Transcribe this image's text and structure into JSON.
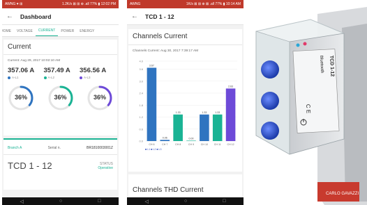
{
  "phone1": {
    "status": {
      "left": "AWNG ♥ ⊞",
      "right": "1.2K/s ⊠ ⊞ ⊕ .all 77% ▮ 12:02 PM"
    },
    "title": "Dashboard",
    "tabs": [
      "HOME",
      "VOLTAGE",
      "CURRENT",
      "POWER",
      "ENERGY"
    ],
    "active_tab": "CURRENT",
    "section_title": "Current",
    "timestamp": "Current: Aug 29, 2017 10:02:10 AM",
    "phases": [
      {
        "value": "357.06 A",
        "label": "A-L1",
        "color": "#2f74c0",
        "percent_text": "36%",
        "percent": 36
      },
      {
        "value": "357.49 A",
        "label": "A-L2",
        "color": "#1ab394",
        "percent_text": "36%",
        "percent": 36
      },
      {
        "value": "356.56 A",
        "label": "A-L3",
        "color": "#6d4ad8",
        "percent_text": "36%",
        "percent": 36
      }
    ],
    "branch": {
      "name": "Branch A",
      "serial_label": "Serial n.",
      "serial": "BR1810003001Z"
    },
    "device_name": "TCD 1 - 12",
    "status_label": "STATUS",
    "status_value": "Operative"
  },
  "phone2": {
    "status": {
      "left": "AWNG",
      "right": "1K/s ⊠ ⊞ ⊕ ⊠ .all 77% ▮ 10:14 AM"
    },
    "title": "TCD 1 - 12",
    "section_title": "Channels Current",
    "timestamp": "Channels Current: Aug 30, 2017 7:39:17 AM",
    "legend": "■ L1 ■ L2 ■ L3",
    "section2_title": "Channels THD Current"
  },
  "chart_data": {
    "type": "bar",
    "title": "",
    "xlabel": "",
    "ylabel": "",
    "ylim": [
      0,
      4.0
    ],
    "yticks": [
      "0.0",
      "0.6",
      "1.2",
      "1.8",
      "2.4",
      "3.0",
      "3.6",
      "4.0"
    ],
    "categories": [
      "CH 6",
      "CH 7",
      "CH 8",
      "CH 9",
      "CH 10",
      "CH 11",
      "CH 12"
    ],
    "values": [
      3.67,
      0.06,
      1.33,
      0.0,
      1.33,
      1.33,
      2.63
    ],
    "value_labels": [
      "3.67",
      "0.06",
      "1.33",
      "0.00",
      "1.33",
      "1.33",
      "2.63"
    ],
    "colors": [
      "#2f74c0",
      "#2f74c0",
      "#1ab394",
      "#1ab394",
      "#2f74c0",
      "#1ab394",
      "#6d4ad8"
    ]
  },
  "device_photo": {
    "text_main": "TCD 1-12",
    "text_brand": "Bluetooth",
    "text_ce": "C E",
    "text_maker": "CARLO GAVAZZI"
  }
}
